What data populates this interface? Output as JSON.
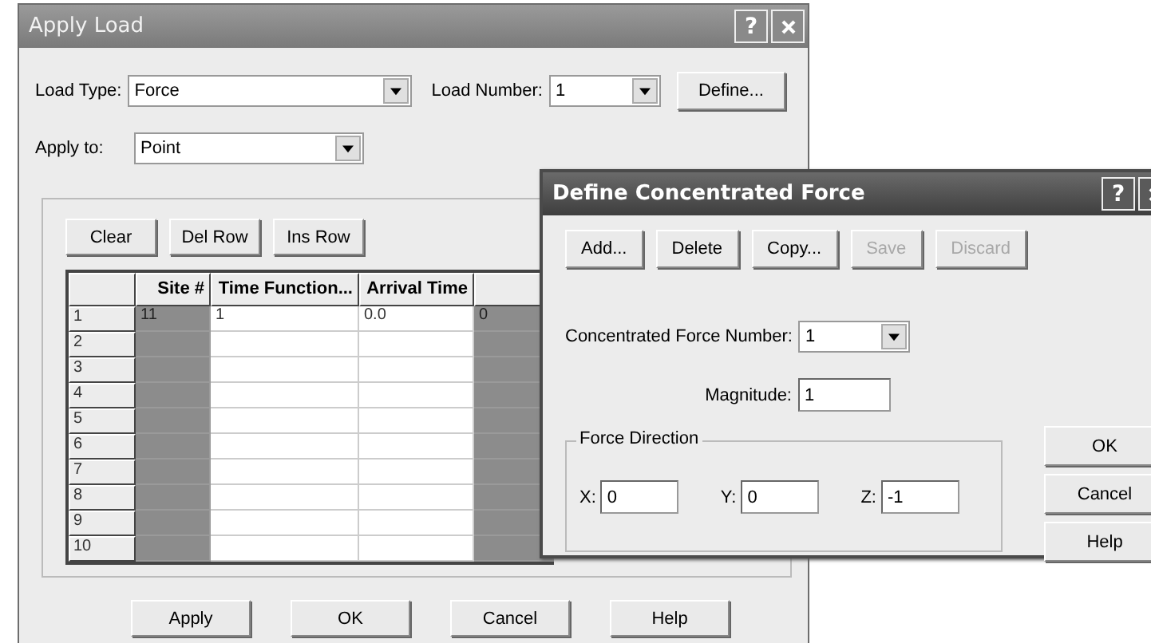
{
  "apply_load": {
    "title": "Apply Load",
    "help_button": "?",
    "load_type": {
      "label": "Load Type:",
      "value": "Force"
    },
    "load_number": {
      "label": "Load Number:",
      "value": "1"
    },
    "define_button": "Define...",
    "apply_to": {
      "label": "Apply to:",
      "value": "Point"
    },
    "table_buttons": [
      "Clear",
      "Del Row",
      "Ins Row"
    ],
    "table": {
      "columns": [
        {
          "label": "Site #",
          "disabled": true
        },
        {
          "label": "Time Function...",
          "disabled": false
        },
        {
          "label": "Arrival Time",
          "disabled": false
        },
        {
          "disabled": true
        }
      ],
      "rows": [
        {
          "index": "1",
          "cells": [
            "11",
            "1",
            "0.0",
            "0"
          ]
        },
        {
          "index": "2",
          "cells": [
            "",
            "",
            "",
            ""
          ]
        },
        {
          "index": "3",
          "cells": [
            "",
            "",
            "",
            ""
          ]
        },
        {
          "index": "4",
          "cells": [
            "",
            "",
            "",
            ""
          ]
        },
        {
          "index": "5",
          "cells": [
            "",
            "",
            "",
            ""
          ]
        },
        {
          "index": "6",
          "cells": [
            "",
            "",
            "",
            ""
          ]
        },
        {
          "index": "7",
          "cells": [
            "",
            "",
            "",
            ""
          ]
        },
        {
          "index": "8",
          "cells": [
            "",
            "",
            "",
            ""
          ]
        },
        {
          "index": "9",
          "cells": [
            "",
            "",
            "",
            ""
          ]
        },
        {
          "index": "10",
          "cells": [
            "",
            "",
            "",
            ""
          ]
        }
      ]
    },
    "buttons": [
      "Apply",
      "OK",
      "Cancel",
      "Help"
    ]
  },
  "define_force": {
    "title": "Define Concentrated Force",
    "help_button": "?",
    "toolbar": [
      {
        "label": "Add...",
        "disabled": false
      },
      {
        "label": "Delete",
        "disabled": false
      },
      {
        "label": "Copy...",
        "disabled": false
      },
      {
        "label": "Save",
        "disabled": true
      },
      {
        "label": "Discard",
        "disabled": true
      }
    ],
    "force_number": {
      "label": "Concentrated Force Number:",
      "value": "1"
    },
    "magnitude": {
      "label": "Magnitude:",
      "value": "1"
    },
    "direction": {
      "title": "Force Direction",
      "fields": [
        {
          "label": "X:",
          "value": "0"
        },
        {
          "label": "Y:",
          "value": "0"
        },
        {
          "label": "Z:",
          "value": "-1"
        }
      ]
    },
    "buttons": [
      "OK",
      "Cancel",
      "Help"
    ]
  }
}
